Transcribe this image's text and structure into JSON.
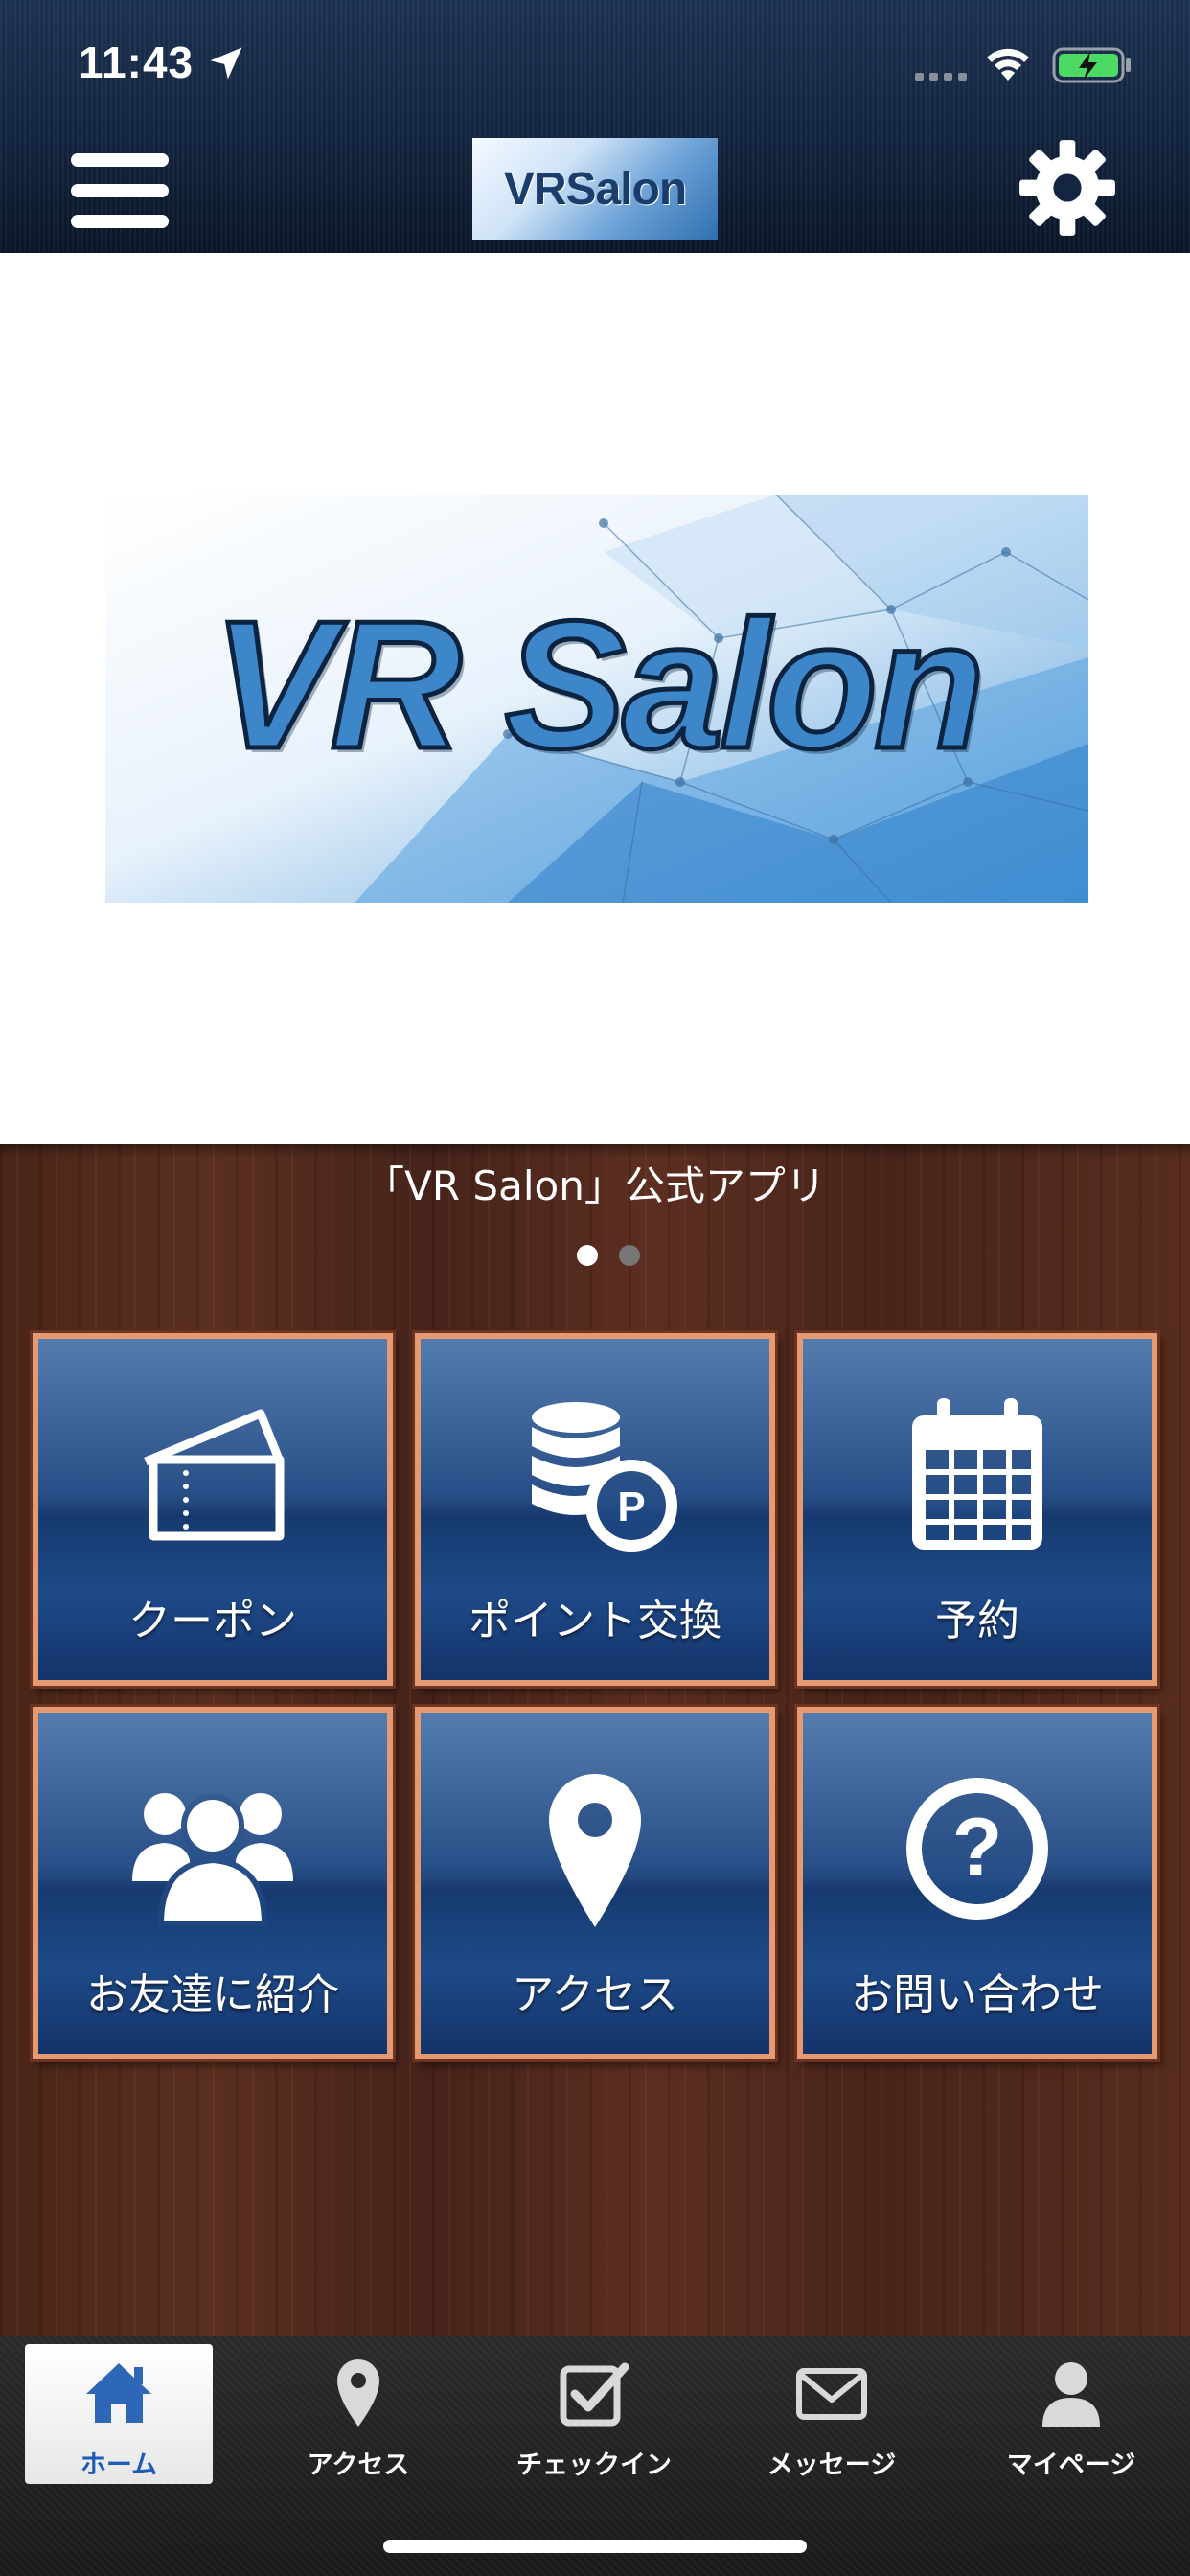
{
  "status_bar": {
    "time": "11:43"
  },
  "header": {
    "logo_text": "VRSalon"
  },
  "banner": {
    "title": "VR Salon"
  },
  "caption": "「VR Salon」公式アプリ",
  "carousel": {
    "pages": 2,
    "current": 1
  },
  "tiles": [
    {
      "label": "クーポン",
      "icon": "coupon-ticket-icon"
    },
    {
      "label": "ポイント交換",
      "icon": "point-coins-icon"
    },
    {
      "label": "予約",
      "icon": "calendar-icon"
    },
    {
      "label": "お友達に紹介",
      "icon": "friends-group-icon"
    },
    {
      "label": "アクセス",
      "icon": "map-pin-icon"
    },
    {
      "label": "お問い合わせ",
      "icon": "question-icon"
    }
  ],
  "tabbar": [
    {
      "label": "ホーム",
      "icon": "home-icon",
      "active": true
    },
    {
      "label": "アクセス",
      "icon": "map-pin-icon",
      "active": false
    },
    {
      "label": "チェックイン",
      "icon": "checkin-checkbox-icon",
      "active": false
    },
    {
      "label": "メッセージ",
      "icon": "envelope-icon",
      "active": false
    },
    {
      "label": "マイページ",
      "icon": "user-icon",
      "active": false
    }
  ],
  "colors": {
    "header_blue": "#132540",
    "tile_blue": "#1d4681",
    "tile_border": "#e59a72",
    "active_tab_text": "#1d5bb6"
  }
}
